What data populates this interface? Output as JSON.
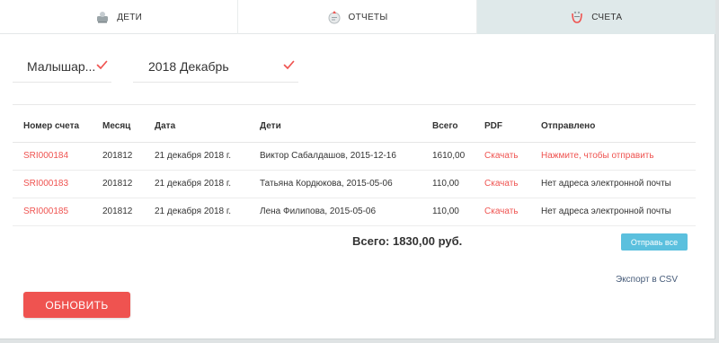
{
  "tabs": [
    {
      "label": "ДЕТИ",
      "icon": "children-icon",
      "active": false
    },
    {
      "label": "ОТЧЕТЫ",
      "icon": "reports-icon",
      "active": false
    },
    {
      "label": "СЧЕТА",
      "icon": "invoices-icon",
      "active": true
    }
  ],
  "filters": {
    "group": "Малышар...",
    "period": "2018 Декабрь"
  },
  "table": {
    "headers": [
      "Номер счета",
      "Месяц",
      "Дата",
      "Дети",
      "Всего",
      "PDF",
      "Отправлено"
    ],
    "rows": [
      {
        "number": "SRI000184",
        "month": "201812",
        "date": "21 декабря 2018 г.",
        "child": "Виктор Сабалдашов, 2015-12-16",
        "total": "1610,00",
        "pdf": "Скачать",
        "sent": "Нажмите, чтобы отправить",
        "sent_is_link": true
      },
      {
        "number": "SRI000183",
        "month": "201812",
        "date": "21 декабря 2018 г.",
        "child": "Татьяна Кордюкова, 2015-05-06",
        "total": "110,00",
        "pdf": "Скачать",
        "sent": "Нет адреса электронной почты",
        "sent_is_link": false
      },
      {
        "number": "SRI000185",
        "month": "201812",
        "date": "21 декабря 2018 г.",
        "child": "Лена Филипова, 2015-05-06",
        "total": "110,00",
        "pdf": "Скачать",
        "sent": "Нет адреса электронной почты",
        "sent_is_link": false
      }
    ]
  },
  "summary": {
    "total_label": "Всего: 1830,00 руб.",
    "send_all_label": "Отправь все",
    "export_label": "Экспорт в CSV"
  },
  "actions": {
    "refresh_label": "ОБНОВИТЬ"
  },
  "colors": {
    "accent_red": "#ef5350",
    "button_blue": "#5bc0de",
    "active_tab": "#dfe9ea"
  }
}
